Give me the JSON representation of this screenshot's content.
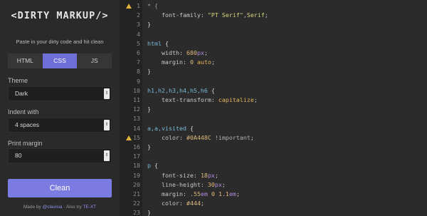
{
  "app": {
    "logo_text": "<DIRTY MARKUP/>",
    "subtitle": "Paste in your dirty code and hit clean"
  },
  "tabs": [
    {
      "label": "HTML",
      "active": false
    },
    {
      "label": "CSS",
      "active": true
    },
    {
      "label": "JS",
      "active": false
    }
  ],
  "settings": {
    "theme": {
      "label": "Theme",
      "value": "Dark"
    },
    "indent": {
      "label": "Indent with",
      "value": "4 spaces"
    },
    "margin": {
      "label": "Print margin",
      "value": "80"
    }
  },
  "buttons": {
    "clean_label": "Clean"
  },
  "footer": {
    "made_by_prefix": "Made by",
    "made_by_link": "@clavisia",
    "separator": "·",
    "also": "Also try",
    "also_link": "TE-XT"
  },
  "editor": {
    "lines": [
      {
        "n": 1,
        "warn": true,
        "tokens": [
          [
            "t-com",
            "* {"
          ]
        ]
      },
      {
        "n": 2,
        "warn": false,
        "tokens": [
          [
            "t-prop",
            "    font-family: "
          ],
          [
            "t-str",
            "\"PT Serif\""
          ],
          [
            "t-prop",
            ","
          ],
          [
            "t-str",
            "Serif"
          ],
          [
            "t-prop",
            ";"
          ]
        ]
      },
      {
        "n": 3,
        "warn": false,
        "tokens": [
          [
            "t-plain",
            "}"
          ]
        ]
      },
      {
        "n": 4,
        "warn": false,
        "tokens": []
      },
      {
        "n": 5,
        "warn": false,
        "tokens": [
          [
            "t-sel",
            "html"
          ],
          [
            "t-plain",
            " {"
          ]
        ]
      },
      {
        "n": 6,
        "warn": false,
        "tokens": [
          [
            "t-prop",
            "    width: "
          ],
          [
            "t-num",
            "680"
          ],
          [
            "t-unit",
            "px"
          ],
          [
            "t-prop",
            ";"
          ]
        ]
      },
      {
        "n": 7,
        "warn": false,
        "tokens": [
          [
            "t-prop",
            "    margin: "
          ],
          [
            "t-num",
            "0"
          ],
          [
            "t-prop",
            " "
          ],
          [
            "t-kw",
            "auto"
          ],
          [
            "t-prop",
            ";"
          ]
        ]
      },
      {
        "n": 8,
        "warn": false,
        "tokens": [
          [
            "t-plain",
            "}"
          ]
        ]
      },
      {
        "n": 9,
        "warn": false,
        "tokens": []
      },
      {
        "n": 10,
        "warn": false,
        "tokens": [
          [
            "t-sel",
            "h1,h2,h3,h4,h5,h6"
          ],
          [
            "t-plain",
            " {"
          ]
        ]
      },
      {
        "n": 11,
        "warn": false,
        "tokens": [
          [
            "t-prop",
            "    text-transform: "
          ],
          [
            "t-kw",
            "capitalize"
          ],
          [
            "t-prop",
            ";"
          ]
        ]
      },
      {
        "n": 12,
        "warn": false,
        "tokens": [
          [
            "t-plain",
            "}"
          ]
        ]
      },
      {
        "n": 13,
        "warn": false,
        "tokens": []
      },
      {
        "n": 14,
        "warn": false,
        "tokens": [
          [
            "t-sel",
            "a,a,visited"
          ],
          [
            "t-plain",
            " {"
          ]
        ]
      },
      {
        "n": 15,
        "warn": true,
        "tokens": [
          [
            "t-prop",
            "    color: "
          ],
          [
            "t-num",
            "#0A448C"
          ],
          [
            "t-imp",
            " !important"
          ],
          [
            "t-prop",
            ";"
          ]
        ]
      },
      {
        "n": 16,
        "warn": false,
        "tokens": [
          [
            "t-plain",
            "}"
          ]
        ]
      },
      {
        "n": 17,
        "warn": false,
        "tokens": []
      },
      {
        "n": 18,
        "warn": false,
        "tokens": [
          [
            "t-sel",
            "p"
          ],
          [
            "t-plain",
            " {"
          ]
        ]
      },
      {
        "n": 19,
        "warn": false,
        "tokens": [
          [
            "t-prop",
            "    font-size: "
          ],
          [
            "t-num",
            "18"
          ],
          [
            "t-unit",
            "px"
          ],
          [
            "t-prop",
            ";"
          ]
        ]
      },
      {
        "n": 20,
        "warn": false,
        "tokens": [
          [
            "t-prop",
            "    line-height: "
          ],
          [
            "t-num",
            "30"
          ],
          [
            "t-unit",
            "px"
          ],
          [
            "t-prop",
            ";"
          ]
        ]
      },
      {
        "n": 21,
        "warn": false,
        "tokens": [
          [
            "t-prop",
            "    margin: "
          ],
          [
            "t-num",
            ".55"
          ],
          [
            "t-unit",
            "em"
          ],
          [
            "t-prop",
            " "
          ],
          [
            "t-num",
            "0 1.1"
          ],
          [
            "t-unit",
            "em"
          ],
          [
            "t-prop",
            ";"
          ]
        ]
      },
      {
        "n": 22,
        "warn": false,
        "tokens": [
          [
            "t-prop",
            "    color: "
          ],
          [
            "t-num",
            "#444"
          ],
          [
            "t-prop",
            ";"
          ]
        ]
      },
      {
        "n": 23,
        "warn": false,
        "tokens": [
          [
            "t-plain",
            "}"
          ]
        ]
      }
    ]
  }
}
